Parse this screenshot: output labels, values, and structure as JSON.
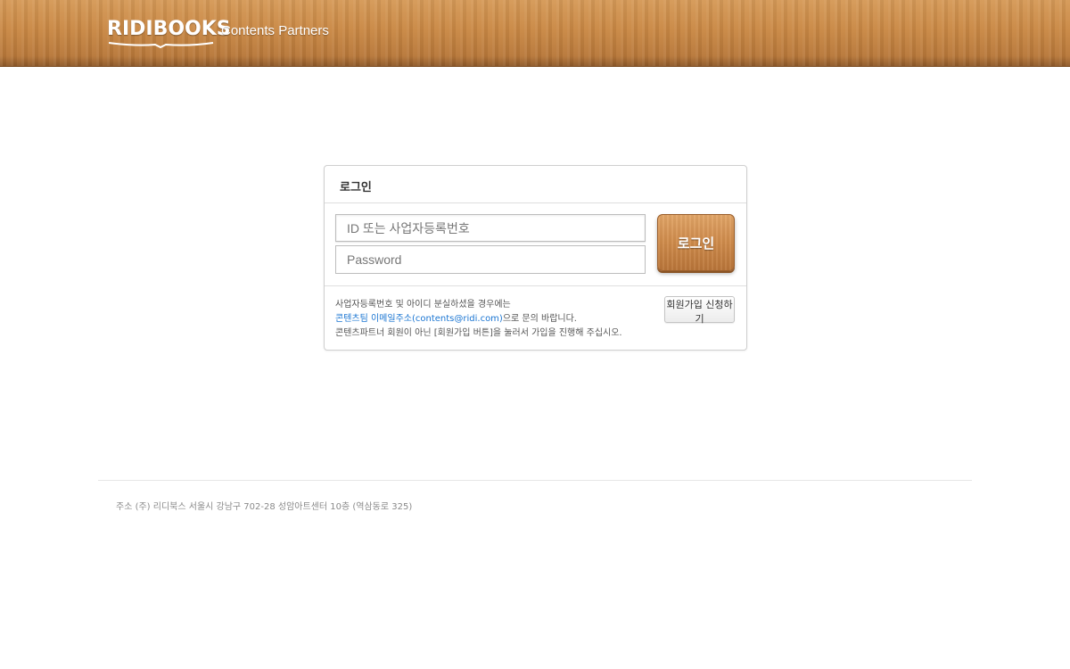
{
  "header": {
    "logo_text": "RIDIBOOKS",
    "logo_subtitle": "Contents Partners"
  },
  "login": {
    "title": "로그인",
    "id_placeholder": "ID 또는 사업자등록번호",
    "password_placeholder": "Password",
    "login_button": "로그인",
    "notice_line1": "사업자등록번호 및 아이디 분실하셨을 경우에는",
    "notice_link": "콘텐츠팀 이메일주소(contents@ridi.com)",
    "notice_line2_suffix": "으로 문의 바랍니다.",
    "notice_line3": "콘텐츠파트너 회원이 아닌 [회원가입 버튼]을 눌러서 가입을 진행해 주십시오.",
    "join_button": "회원가입 신청하기"
  },
  "footer": {
    "address": "주소 (주) 리디북스 서울시 강남구 702-28 성암아트센터 10층 (역삼동로 325)"
  }
}
